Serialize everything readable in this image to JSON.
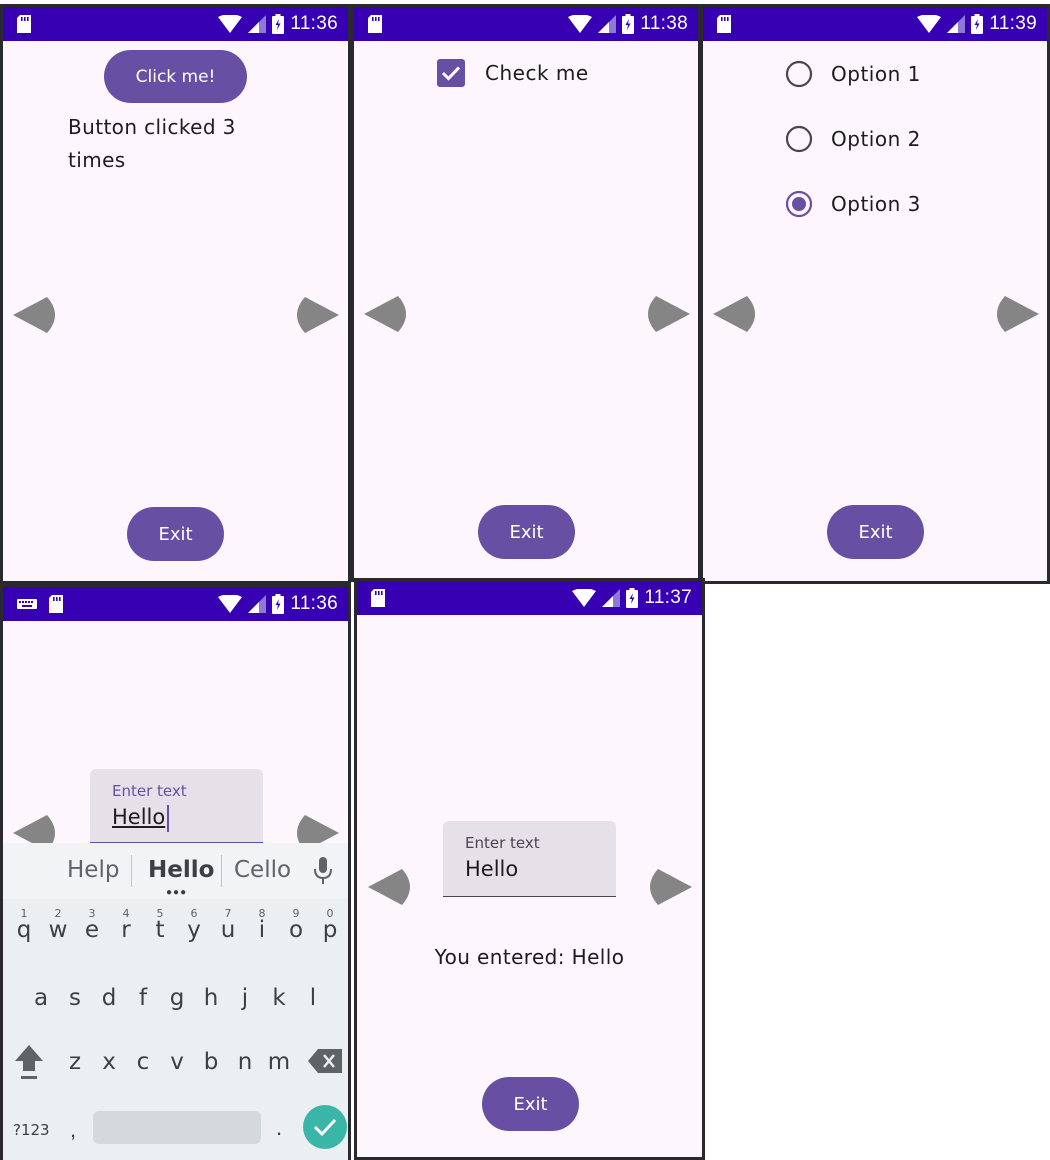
{
  "colors": {
    "statusbar": "#3700b3",
    "accent": "#6750a4",
    "background": "#fdf6fd",
    "nav_arrow": "#858585",
    "field_bg": "#e6e0e9",
    "keyboard_bg": "#eceff1",
    "enter_key": "#3ab6a9"
  },
  "screens": [
    {
      "status_time": "11:36",
      "click_button_label": "Click me!",
      "counter_text": "Button clicked 3 times",
      "exit_label": "Exit"
    },
    {
      "status_time": "11:38",
      "checkbox_label": "Check me",
      "checkbox_checked": true,
      "exit_label": "Exit"
    },
    {
      "status_time": "11:39",
      "options": [
        {
          "label": "Option 1",
          "selected": false
        },
        {
          "label": "Option 2",
          "selected": false
        },
        {
          "label": "Option 3",
          "selected": true
        }
      ],
      "exit_label": "Exit"
    },
    {
      "status_time": "11:36",
      "field_label": "Enter text",
      "field_value": "Hello",
      "keyboard": {
        "suggestions": [
          "Help",
          "Hello",
          "Cello"
        ],
        "row1": [
          "q",
          "w",
          "e",
          "r",
          "t",
          "y",
          "u",
          "i",
          "o",
          "p"
        ],
        "row1_numbers": [
          "1",
          "2",
          "3",
          "4",
          "5",
          "6",
          "7",
          "8",
          "9",
          "0"
        ],
        "row2": [
          "a",
          "s",
          "d",
          "f",
          "g",
          "h",
          "j",
          "k",
          "l"
        ],
        "row3": [
          "z",
          "x",
          "c",
          "v",
          "b",
          "n",
          "m"
        ],
        "symbols_key": "?123",
        "comma_key": ",",
        "period_key": "."
      }
    },
    {
      "status_time": "11:37",
      "field_label": "Enter text",
      "field_value": "Hello",
      "result_text": "You entered: Hello",
      "exit_label": "Exit"
    }
  ]
}
